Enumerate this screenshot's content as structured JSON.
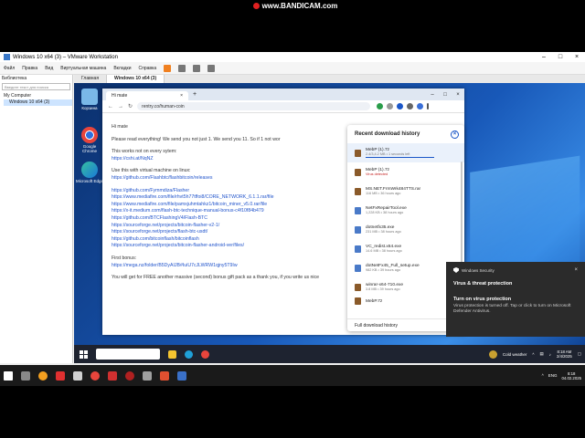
{
  "recorder": {
    "watermark": "www.BANDICAM.com"
  },
  "vmware": {
    "title": "Windows 10 x64 (3) – VMware Workstation",
    "menu": [
      "Файл",
      "Правка",
      "Вид",
      "Виртуальная машина",
      "Вкладки",
      "Справка"
    ],
    "library": {
      "title": "Библиотека",
      "search_placeholder": "Введите текст для поиска",
      "tree": [
        "My Computer",
        "Windows 10 x64 (3)"
      ]
    },
    "tabs": [
      "Главная",
      "Windows 10 x64 (3)"
    ],
    "status": "To return to your computer, move the mouse pointer outside or press Ctrl+Alt."
  },
  "desktop": {
    "icons": [
      {
        "label": "Корзина",
        "icon": "recycle-bin-icon",
        "color": "#7ab8e8"
      },
      {
        "label": "Google Chrome",
        "icon": "chrome-icon",
        "color": "#e8453c"
      },
      {
        "label": "Microsoft Edge",
        "icon": "edge-icon",
        "color": "#1fa0d8"
      }
    ]
  },
  "browser": {
    "tab_title": "Hi mate",
    "url": "rentry.co/human-coin",
    "content": {
      "greeting": "Hi mate",
      "intro": "Please read everything! We send you not just 1. We send you 11. So if 1 not wor",
      "line2": "This works not on every sytem:",
      "link_a": "https://cshi.at/NqNZ",
      "line3": "Use this with virtual machine on linux:",
      "link_b": "https://github.com/Flashbtc/flashbitcoin/releases",
      "links": [
        "https://github.com/Fymmdiza/Flasher",
        "https://www.mediafire.com/file/rhvt5h77tffoi8/CORE_NETWORK_6.1.1.rar/file",
        "https://www.mediafire.com/file/pamxjuhmtahkz1/bitcoin_miner_v5.0.rar/file",
        "https://x-it.medium.com/flash-btc-technique-manual-bonus-c4f10f84b479",
        "https://github.com/BTCFlashingV4/Flash-BTC",
        "https://sourceforge.net/projects/bitcoin-flasher-v2-1/",
        "https://sourceforge.net/projects/flash-btc-usdt/",
        "https://github.com/bitcoinflash/bitcoinflash",
        "https://sourceforge.net/projects/bitcoin-flasher-android-ver/files/"
      ],
      "bonus_title": "First bonus:",
      "bonus_link": "https://mega.nz/folder/B5DyAIJB#IuiU7cJLWRW1qjny5T9Iw",
      "footer": "You will get for FREE another massive (second) bonus gift pack as a thank you, if you write us nice"
    }
  },
  "downloads": {
    "title": "Recent download history",
    "items": [
      {
        "name": "MebP (1).7z",
        "status": "2.4/3,4.2 MB • 1 seconds left",
        "danger": false,
        "progress": 0.75
      },
      {
        "name": "MebP (1).7z",
        "status": "Virus detected",
        "danger": true
      },
      {
        "name": "MS.NET.FrmWrk484TTS.rar",
        "status": "116 MB • 36 hours ago",
        "danger": false
      },
      {
        "name": "NetFxRepairTool.exe",
        "status": "1,228 KB • 38 hours ago",
        "danger": false
      },
      {
        "name": "dotnetfx35.exe",
        "status": "231 MB • 38 hours ago",
        "danger": false
      },
      {
        "name": "VC_redist.x64.exe",
        "status": "14.6 MB • 38 hours ago",
        "danger": false
      },
      {
        "name": "dotNetFx45_Full_setup.exe",
        "status": "982 KB • 39 hours ago",
        "danger": false
      },
      {
        "name": "winrar-x64-710.exe",
        "status": "3.8 MB • 39 hours ago",
        "danger": false
      },
      {
        "name": "MebP.7z",
        "status": "",
        "danger": false
      }
    ],
    "footer": "Full download history"
  },
  "toast": {
    "app": "Windows Security",
    "heading": "Virus & threat protection",
    "title": "Turn on virus protection",
    "body": "Virus protection is turned off. Tap or click to turn on Microsoft Defender Antivirus."
  },
  "guest_taskbar": {
    "weather": "Cold weather",
    "time": "8:18 AM",
    "date": "2/4/2025"
  },
  "host_taskbar": {
    "lang": "ENG",
    "time": "8:18",
    "date": "04.02.2025"
  }
}
